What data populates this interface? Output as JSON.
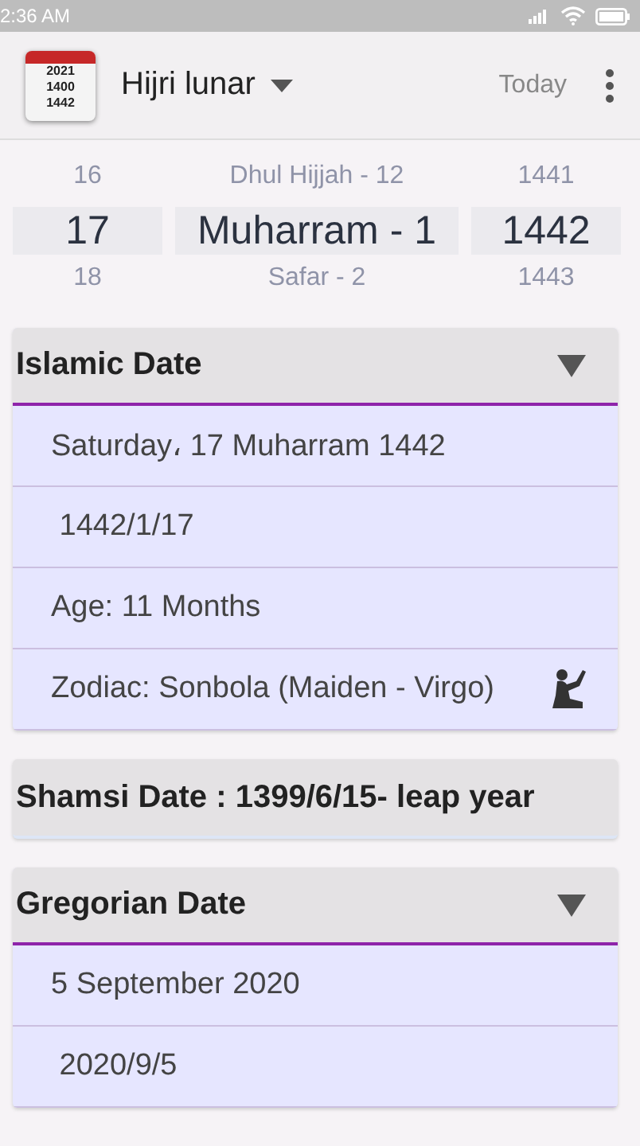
{
  "status_bar": {
    "time": "2:36 AM"
  },
  "app_bar": {
    "icon_lines": [
      "2021",
      "1400",
      "1442"
    ],
    "title": "Hijri lunar",
    "action": "Today"
  },
  "picker": {
    "columns": [
      {
        "above": "16",
        "selected": "17",
        "below": "18"
      },
      {
        "above": "Dhul Hijjah - 12",
        "selected": "Muharram - 1",
        "below": "Safar - 2"
      },
      {
        "above": "1441",
        "selected": "1442",
        "below": "1443"
      }
    ]
  },
  "sections": [
    {
      "kind": "expandable",
      "title": "Islamic Date",
      "expanded": true,
      "rows": [
        {
          "kind": "text",
          "text": "Saturday، 17 Muharram 1442"
        },
        {
          "kind": "text",
          "text": " 1442/1/17"
        },
        {
          "kind": "text",
          "text": "Age: 11 Months"
        },
        {
          "kind": "zodiac",
          "text": "Zodiac: Sonbola (Maiden - Virgo)"
        }
      ]
    },
    {
      "kind": "single",
      "title": "Shamsi Date :  1399/6/15- leap year"
    },
    {
      "kind": "expandable",
      "title": "Gregorian Date",
      "expanded": true,
      "rows": [
        {
          "kind": "text",
          "text": "5 September 2020"
        },
        {
          "kind": "text",
          "text": " 2020/9/5"
        }
      ]
    }
  ]
}
